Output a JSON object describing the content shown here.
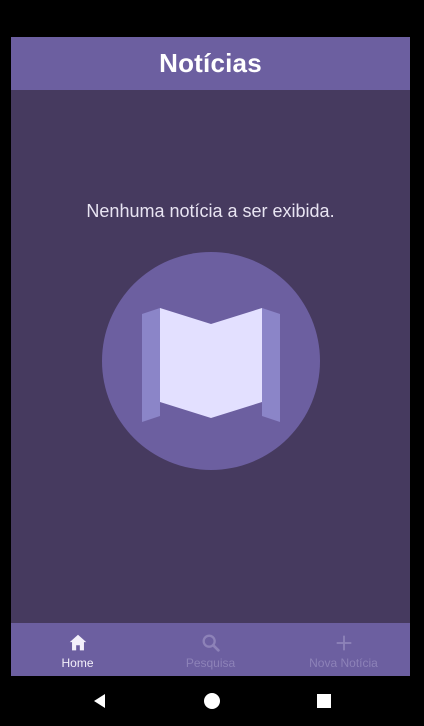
{
  "header": {
    "title": "Notícias"
  },
  "main": {
    "empty_message": "Nenhuma notícia a ser exibida.",
    "illustration_icon": "open-book-icon"
  },
  "bottom_nav": {
    "items": [
      {
        "label": "Home",
        "icon": "home-icon",
        "active": true
      },
      {
        "label": "Pesquisa",
        "icon": "search-icon",
        "active": false
      },
      {
        "label": "Nova Notícia",
        "icon": "plus-icon",
        "active": false
      }
    ]
  },
  "system_nav": {
    "back": "back-icon",
    "home": "home-circle-icon",
    "recents": "recents-square-icon"
  },
  "colors": {
    "header": "#6c5fa0",
    "background": "#463a5f",
    "illustration_circle": "#6c5fa0",
    "page": "#e3e0ff",
    "page_side": "#8b85c8",
    "nav_inactive": "#8d82b8"
  }
}
